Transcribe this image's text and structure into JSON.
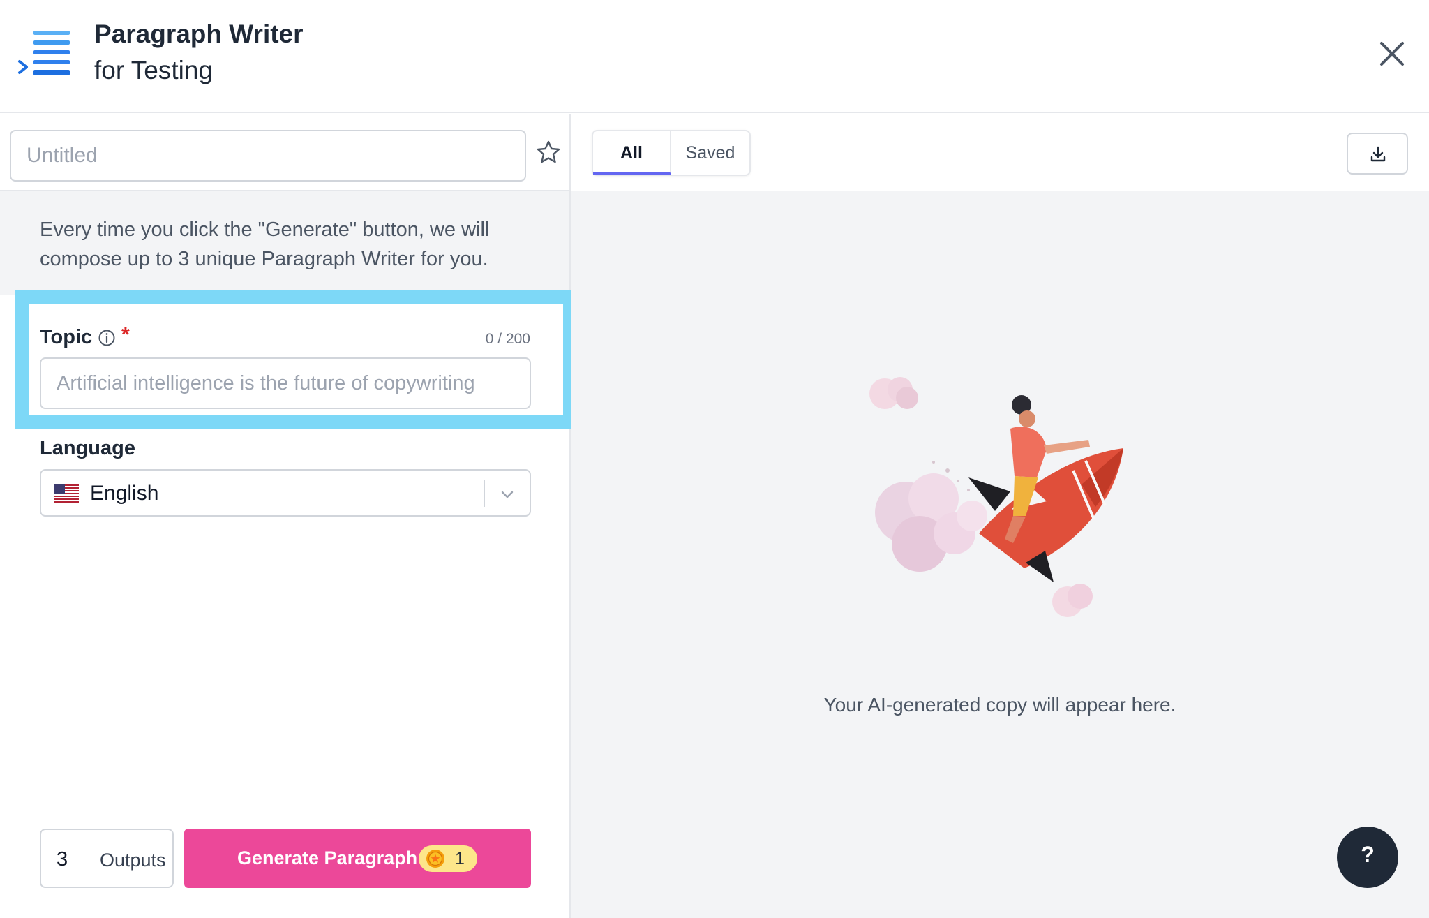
{
  "header": {
    "title": "Paragraph Writer",
    "subtitle": "for Testing",
    "logo_icon": "list-logo-icon",
    "close_icon": "close-icon"
  },
  "document": {
    "title_placeholder": "Untitled",
    "title_value": "",
    "favorite_icon": "star-icon"
  },
  "info": {
    "text": "Every time you click the \"Generate\" button, we will compose up to 3 unique Paragraph Writer for you."
  },
  "form": {
    "topic": {
      "label": "Topic",
      "required_mark": "*",
      "counter": "0 / 200",
      "placeholder": "Artificial intelligence is the future of copywriting",
      "value": "",
      "info_icon": "info-icon"
    },
    "language": {
      "label": "Language",
      "selected": "English",
      "flag_icon": "us-flag-icon"
    }
  },
  "footer": {
    "outputs_count": "3",
    "outputs_label": "Outputs",
    "generate_label": "Generate Paragraph",
    "credit_cost": "1",
    "coin_icon": "coin-icon"
  },
  "results": {
    "tabs": [
      {
        "label": "All",
        "active": true
      },
      {
        "label": "Saved",
        "active": false
      }
    ],
    "download_icon": "download-icon",
    "empty_message": "Your AI-generated copy will appear here.",
    "help_label": "?"
  },
  "colors": {
    "primary": "#ec4899",
    "highlight": "#7dd8f7",
    "tab_indicator": "#6366f1",
    "logo_blue": "#2f80ed",
    "help_button": "#1f2937"
  }
}
